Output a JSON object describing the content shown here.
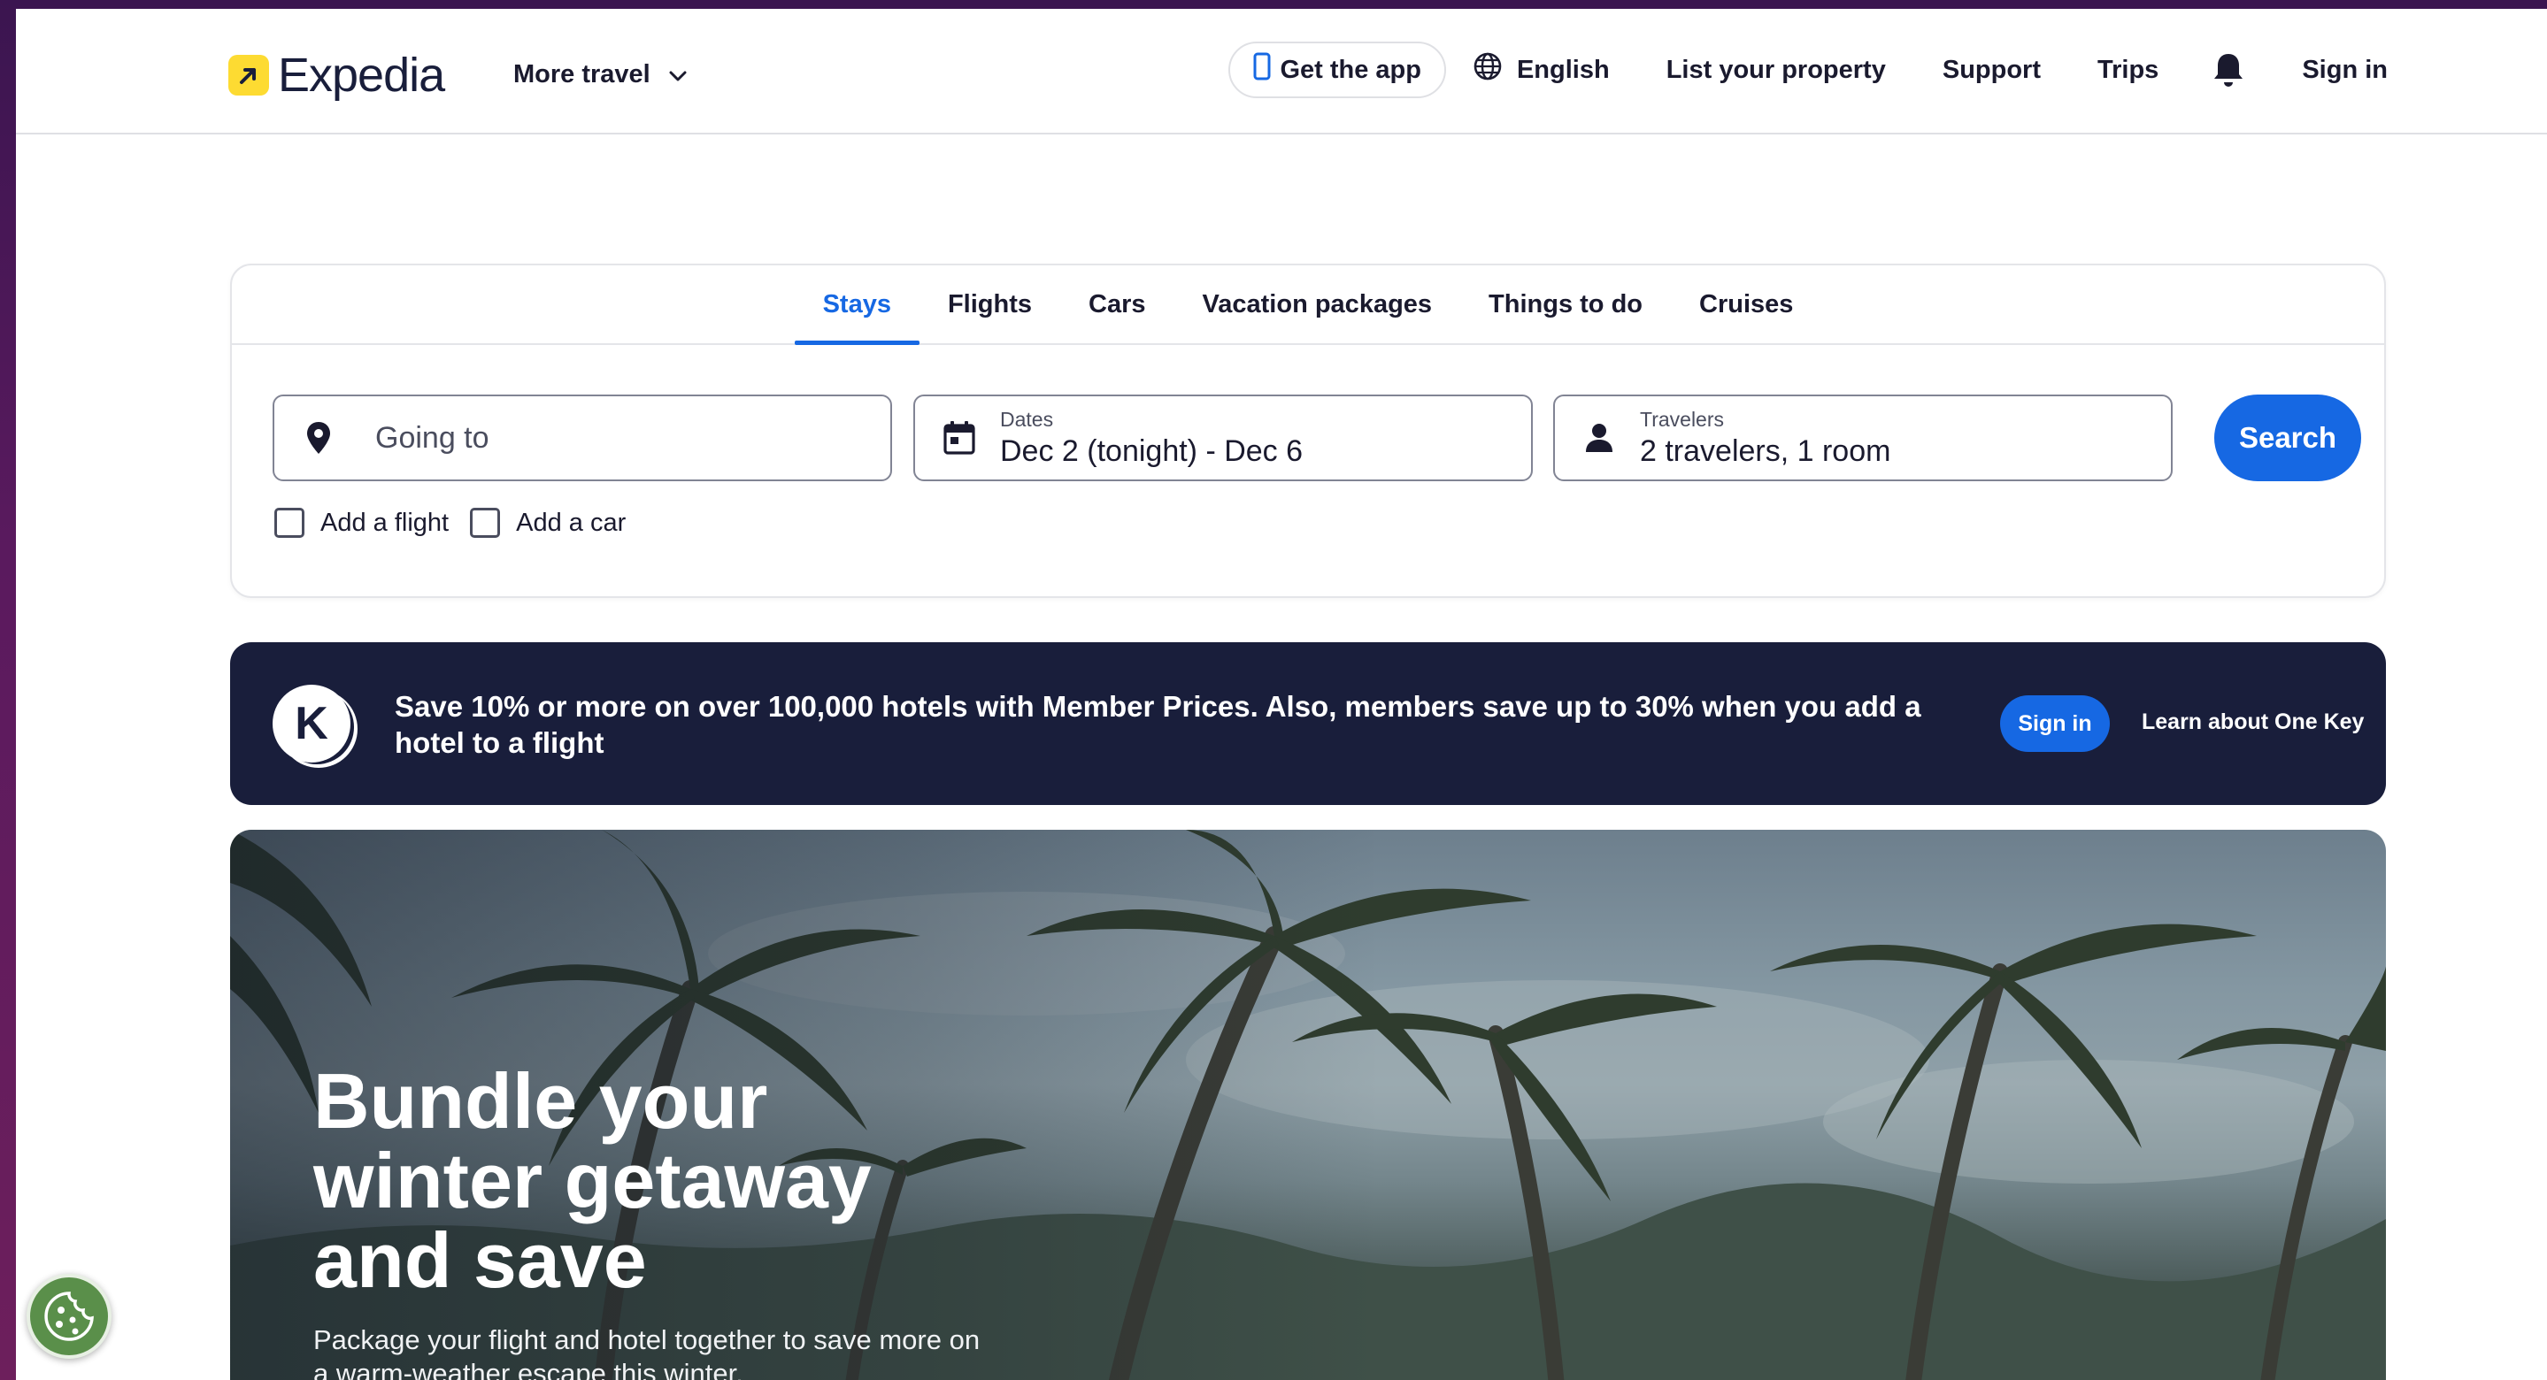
{
  "header": {
    "brand": "Expedia",
    "more_travel": "More travel",
    "get_app": "Get the app",
    "language": "English",
    "list_property": "List your property",
    "support": "Support",
    "trips": "Trips",
    "sign_in": "Sign in"
  },
  "search": {
    "tabs": [
      {
        "label": "Stays",
        "active": true
      },
      {
        "label": "Flights"
      },
      {
        "label": "Cars"
      },
      {
        "label": "Vacation packages"
      },
      {
        "label": "Things to do"
      },
      {
        "label": "Cruises"
      }
    ],
    "destination_placeholder": "Going to",
    "dates_label": "Dates",
    "dates_value": "Dec 2 (tonight) - Dec 6",
    "travelers_label": "Travelers",
    "travelers_value": "2 travelers, 1 room",
    "search_button": "Search",
    "add_flight": "Add a flight",
    "add_car": "Add a car"
  },
  "banner": {
    "text": "Save 10% or more on over 100,000 hotels with Member Prices. Also, members save up to 30% when you add a hotel to a flight",
    "sign_in": "Sign in",
    "learn": "Learn about One Key",
    "logo_letter": "K"
  },
  "hero": {
    "title": "Bundle your winter getaway and save",
    "subtitle": "Package your flight and hotel together to save more on a warm-weather escape this winter."
  },
  "colors": {
    "accent": "#1668e3",
    "banner_bg": "#191e3b",
    "logo_yellow": "#fddb32"
  },
  "icons": [
    "expedia-logo-icon",
    "chevron-down-icon",
    "phone-icon",
    "globe-icon",
    "bell-icon",
    "location-pin-icon",
    "calendar-icon",
    "person-icon",
    "one-key-icon",
    "cookie-icon"
  ]
}
